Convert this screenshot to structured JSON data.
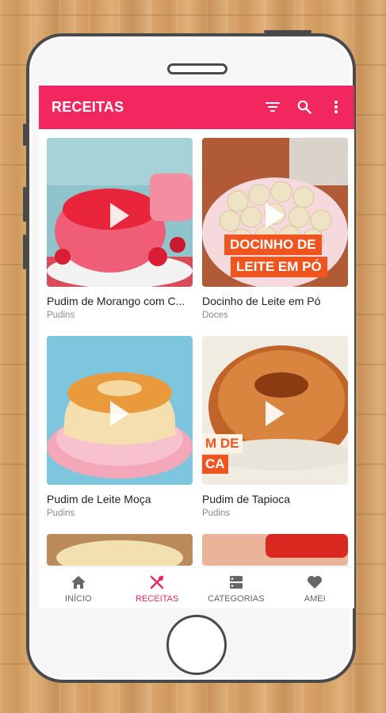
{
  "appbar": {
    "title": "RECEITAS",
    "actions": [
      "filter-icon",
      "search-icon",
      "more-vert-icon"
    ]
  },
  "recipes": [
    {
      "title": "Pudim de Morango com C...",
      "category": "Pudins"
    },
    {
      "title": "Docinho de Leite em Pó",
      "category": "Doces",
      "overlay": [
        "DOCINHO DE",
        "LEITE EM PÓ"
      ]
    },
    {
      "title": "Pudim de Leite Moça",
      "category": "Pudins"
    },
    {
      "title": "Pudim de Tapioca",
      "category": "Pudins",
      "overlay": [
        "M DE",
        "CA"
      ]
    }
  ],
  "bottom_nav": [
    {
      "label": "INÍCIO",
      "icon": "home-icon",
      "active": false
    },
    {
      "label": "RECEITAS",
      "icon": "fork-knife-icon",
      "active": true
    },
    {
      "label": "CATEGORIAS",
      "icon": "categories-icon",
      "active": false
    },
    {
      "label": "AMEI",
      "icon": "heart-icon",
      "active": false
    }
  ],
  "colors": {
    "accent": "#f3275f",
    "title_text": "#222222",
    "secondary_text": "#8a8a8a"
  }
}
